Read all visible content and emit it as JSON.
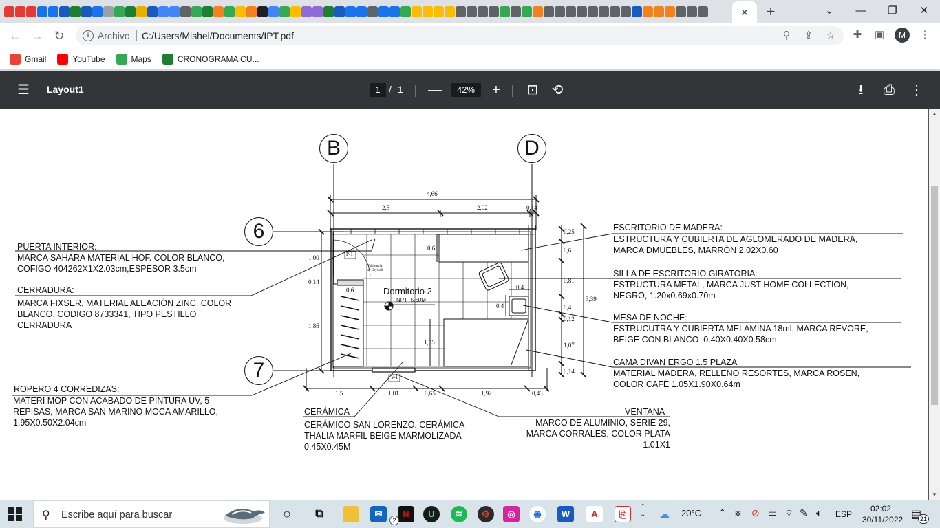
{
  "browser": {
    "tab_favicon_colors": [
      "#e53935",
      "#e53935",
      "#e53935",
      "#1a73e8",
      "#1a73e8",
      "#185abd",
      "#1e7e34",
      "#185abd",
      "#1a73e8",
      "#9aa0a6",
      "#34a853",
      "#1e7e34",
      "#e6b000",
      "#185abd",
      "#4285f4",
      "#4285f4",
      "#5f6368",
      "#34a853",
      "#1e7e34",
      "#f4811f",
      "#34a853",
      "#fbbc04",
      "#f4811f",
      "#202124",
      "#4285f4",
      "#34a853",
      "#fbbc04",
      "#8f6bd6",
      "#8f6bd6",
      "#1e7e34",
      "#185abd",
      "#1a73e8",
      "#1a73e8",
      "#5f6368",
      "#1a73e8",
      "#1a73e8",
      "#34a853",
      "#fbbc04",
      "#fbbc04",
      "#fbbc04",
      "#fbbc04",
      "#5f6368",
      "#5f6368",
      "#5f6368",
      "#5f6368",
      "#34a853",
      "#5f6368",
      "#34a853",
      "#f4811f",
      "#5f6368",
      "#5f6368",
      "#5f6368",
      "#5f6368",
      "#5f6368",
      "#5f6368",
      "#5f6368",
      "#5f6368",
      "#185abd",
      "#f4811f",
      "#f4811f",
      "#f4811f",
      "#5f6368",
      "#5f6368",
      "#5f6368"
    ],
    "close_tab_glyph": "✕",
    "new_tab_glyph": "+",
    "window_controls": {
      "dropdown": "⌄",
      "minimize": "—",
      "restore": "❐",
      "close": "✕"
    },
    "address_prefix": "Archivo",
    "address_url": "C:/Users/Mishel/Documents/IPT.pdf",
    "avatar_letter": "M",
    "bookmarks": [
      {
        "label": "Gmail",
        "icon": "gmail-icon",
        "color": "#ea4335"
      },
      {
        "label": "YouTube",
        "icon": "youtube-icon",
        "color": "#ff0000"
      },
      {
        "label": "Maps",
        "icon": "maps-icon",
        "color": "#34a853"
      },
      {
        "label": "CRONOGRAMA CU...",
        "icon": "excel-icon",
        "color": "#1e7e34"
      }
    ]
  },
  "pdf": {
    "title": "Layout1",
    "page_current": "1",
    "page_separator": "/",
    "page_total": "1",
    "zoom": "42%"
  },
  "drawing": {
    "axes": {
      "b": "B",
      "d": "D",
      "six": "6",
      "seven": "7"
    },
    "room_name": "Dormitorio 2",
    "room_level": "NPT+5.50M",
    "tag_door": "P-1",
    "tag_window": "V-1",
    "tabiqueria": "Tabiquería\nde Drywall",
    "dims_top": {
      "total": "4,66",
      "a": "2,5",
      "b": "2,02",
      "c": "0,14"
    },
    "dims_bottom": {
      "a": "1,5",
      "b": "1,01",
      "c": "0,65",
      "d": "1,92",
      "e": "0,43"
    },
    "dims_left": {
      "a": "1.00",
      "b": "0,14",
      "c": "1,86"
    },
    "dims_right": {
      "a": "0,25",
      "b": "0,6",
      "c": "0,81",
      "d": "0,4",
      "e": "0,12",
      "f": "1,07",
      "g": "0,14",
      "total": "3,39"
    },
    "dims_inner": {
      "a": "0,6",
      "b": "0,6",
      "c": "0,4",
      "d": "0,4",
      "e": "1,05"
    },
    "labels": {
      "puerta_title": "PUERTA INTERIOR:",
      "puerta_desc": "MARCA SAHARA MATERIAL HOF. COLOR BLANCO,\nCOFIGO 404262X1X2.03cm,ESPESOR 3.5cm",
      "cerradura_title": "CERRADURA:",
      "cerradura_desc": "MARCA FIXSER, MATERIAL ALEACIÓN ZINC, COLOR\nBLANCO, CODIGO 8733341, TIPO PESTILLO\nCERRADURA",
      "ropero_title": "ROPERO 4 CORREDIZAS:",
      "ropero_desc": "MATERI MOP CON ACABADO DE PINTURA UV, 5\nREPISAS, MARCA SAN MARINO MOCA AMARILLO,\n1.95X0.50X2.04cm",
      "ceramica_title": "CERÁMICA",
      "ceramica_desc": "CERÁMICO SAN LORENZO. CERÁMICA\nTHALIA MARFIL BEIGE MARMOLIZADA\n0.45X0.45M",
      "ventana_title": "VENTANA",
      "ventana_desc": "MARCO DE ALUMINIO, SERIE 29,\nMARCA CORRALES, COLOR PLATA\n1.01X1",
      "escritorio_title": "ESCRITORIO DE MADERA:",
      "escritorio_desc": "ESTRUCTURA Y CUBIERTA DE AGLOMERADO DE MADERA,\nMARCA DMUEBLES, MARRÓN 2.02X0.60",
      "silla_title": "SILLA DE ESCRITORIO GIRATORIA:",
      "silla_desc": "ESTRUCTURA METAL, MARCA JUST HOME COLLECTION,\nNEGRO, 1.20x0.69x0.70m",
      "mesa_title": "MESA DE NOCHE:",
      "mesa_desc": "ESTRUCUTRA Y CUBIERTA MELAMINA 18ml, MARCA REVORE,\nBEIGE CON BLANCO  0.40X0.40X0.58cm",
      "cama_title": "CAMA DIVAN ERGO 1.5 PLAZA",
      "cama_desc": "MATERIAL MADERA, RELLENO RESORTES, MARCA ROSEN,\nCOLOR CAFÉ 1.05X1.90X0.64m"
    }
  },
  "taskbar": {
    "search_placeholder": "Escribe aquí para buscar",
    "weather": "20°C",
    "language": "ESP",
    "time": "02:02",
    "date": "30/11/2022",
    "notification_count": "21",
    "mail_badge": "2"
  }
}
